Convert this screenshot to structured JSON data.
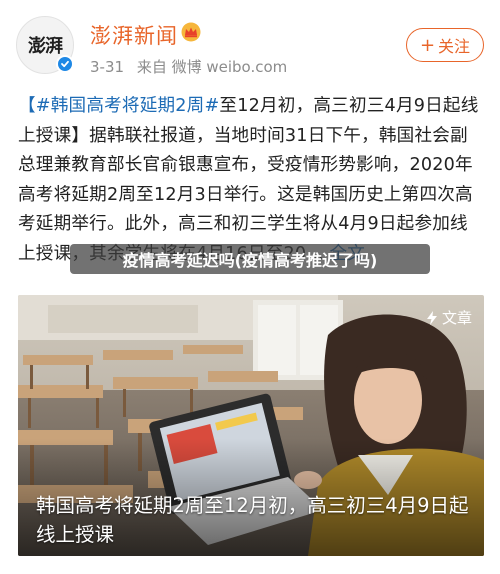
{
  "header": {
    "avatar_text": "澎湃",
    "username": "澎湃新闻",
    "date": "3-31",
    "source": "来自 微博 weibo.com",
    "follow_label": "关注",
    "follow_plus": "+"
  },
  "post": {
    "topic": "【#韩国高考将延期2周#",
    "body": "至12月初，高三初三4月9日起线上授课】据韩联社报道，当地时间31日下午，韩国社会副总理兼教育部长官俞银惠宣布，受疫情形势影响，2020年高考将延期2周至12月3日举行。这是韩国历史上第四次高考延期举行。此外，高三和初三学生将从4月9日起参加线上授课，其余学生将在4月16日至20",
    "ellipsis": "...",
    "full_text_link": "全文"
  },
  "overlay": {
    "title": "疫情高考延迟吗(疫情高考推迟了吗)"
  },
  "media": {
    "badge": "文章",
    "caption": "韩国高考将延期2周至12月初，高三初三4月9日起线上授课"
  },
  "colors": {
    "accent": "#e8652a",
    "link": "#1d6bb5",
    "verified": "#1e88e5"
  }
}
